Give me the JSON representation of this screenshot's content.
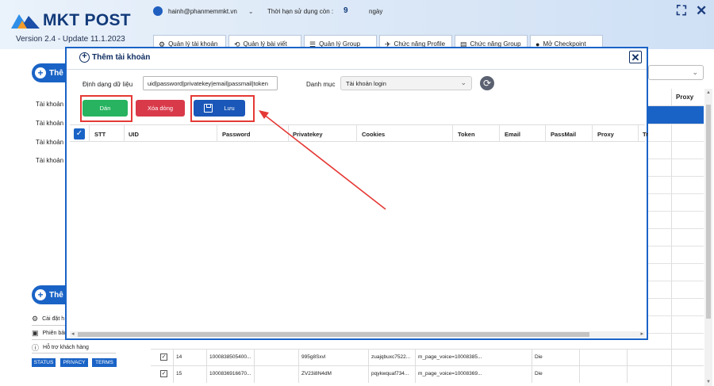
{
  "app": {
    "logo_text": "MKT POST",
    "version": "Version 2.4 - Update 11.1.2023",
    "user_email": "hainh@phanmemmkt.vn",
    "expiry_label": "Thời hạn sử dụng còn :",
    "expiry_value": "9",
    "expiry_unit": "ngày"
  },
  "nav_tabs": [
    {
      "label": "Quản lý tài khoản",
      "icon": "settings-icon"
    },
    {
      "label": "Quản lý bài viết",
      "icon": "refresh-icon"
    },
    {
      "label": "Quản lý Group",
      "icon": "list-icon"
    },
    {
      "label": "Chức năng Profile",
      "icon": "plane-icon"
    },
    {
      "label": "Chức năng Group",
      "icon": "doc-icon"
    },
    {
      "label": "Mở Checkpoint",
      "icon": "user-icon"
    }
  ],
  "sidebar": {
    "top_button": "Thê",
    "items": [
      "Tài khoản",
      "Tài khoản",
      "Tài khoản",
      "Tài khoản"
    ],
    "bottom_button": "Thê",
    "links": [
      "Cài đặt h",
      "Phiên bản",
      "Hỗ trợ khách hàng"
    ],
    "badges": [
      "STATUS",
      "PRIVACY",
      "TERMS"
    ]
  },
  "background_table": {
    "proxy_header": "Proxy",
    "rows": [
      {
        "stt": "14",
        "uid": "1000838505400...",
        "privatekey": "995g8Sxvl",
        "cookies": "zuajqbuxc7522...",
        "token": "m_page_voice=10008385...",
        "status": "Die"
      },
      {
        "stt": "15",
        "uid": "1000836916670...",
        "privatekey": "ZV23i8N4dM",
        "cookies": "pqykwquaf734...",
        "token": "m_page_voice=10008369...",
        "status": "Die"
      }
    ]
  },
  "dialog": {
    "title": "Thêm tài khoản",
    "format_label": "Định dạng dữ liệu",
    "format_value": "uid|password|privatekey|email|passmail|token",
    "category_label": "Danh mục",
    "category_value": "Tài khoản login",
    "buttons": {
      "paste": "Dán",
      "delete_row": "Xóa dòng",
      "save": "Lưu"
    },
    "columns": [
      "STT",
      "UID",
      "Password",
      "Privatekey",
      "Cookies",
      "Token",
      "Email",
      "PassMail",
      "Proxy",
      "Tr"
    ]
  },
  "colors": {
    "primary": "#1a63c6",
    "paste_button": "#27b35f",
    "delete_button": "#d93a4a",
    "save_button": "#1a57b8",
    "highlight": "#e53935"
  }
}
